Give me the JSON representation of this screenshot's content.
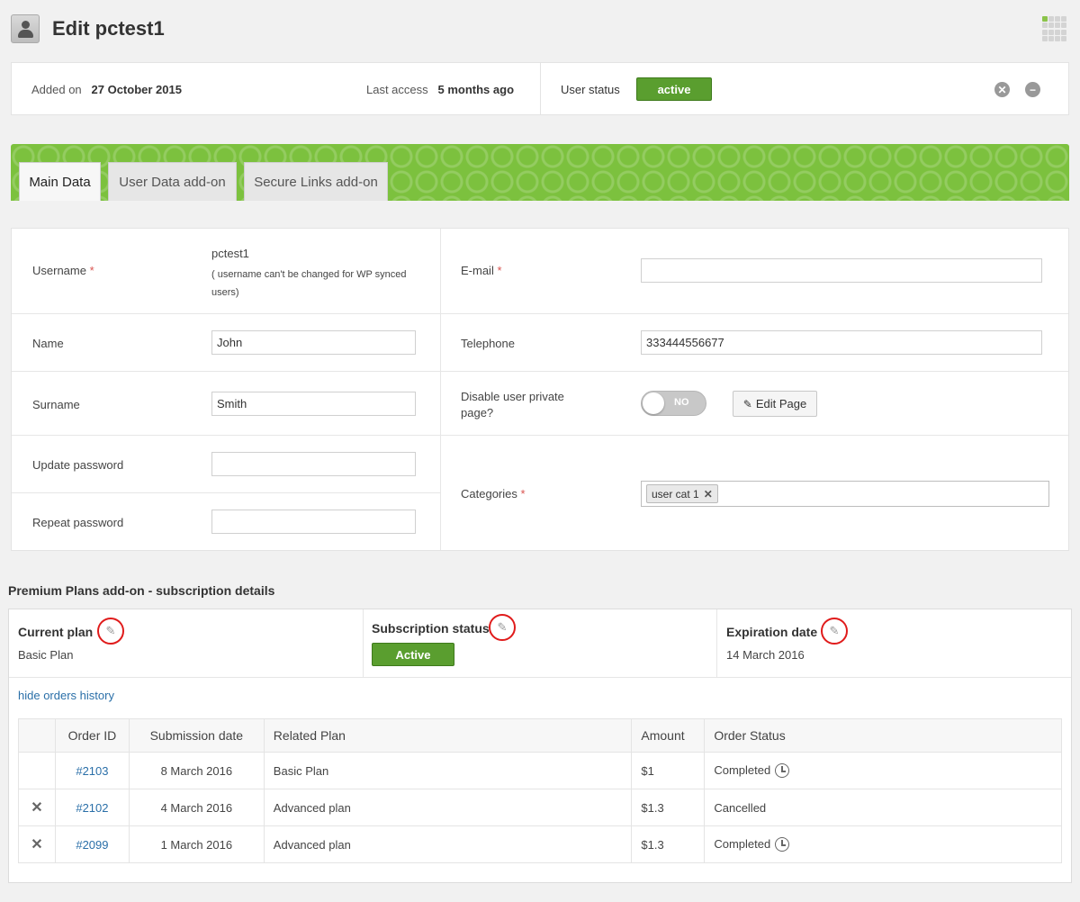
{
  "page": {
    "title": "Edit pctest1"
  },
  "info": {
    "added_label": "Added on",
    "added_value": "27 October 2015",
    "access_label": "Last access",
    "access_value": "5 months ago",
    "status_label": "User status",
    "status_value": "active"
  },
  "tabs": [
    {
      "label": "Main Data",
      "active": true
    },
    {
      "label": "User Data add-on",
      "active": false
    },
    {
      "label": "Secure Links add-on",
      "active": false
    }
  ],
  "form": {
    "username_label": "Username",
    "username_value": "pctest1",
    "username_note": "( username can't be changed for WP synced users)",
    "email_label": "E-mail",
    "email_value": "",
    "name_label": "Name",
    "name_value": "John",
    "telephone_label": "Telephone",
    "telephone_value": "333444556677",
    "surname_label": "Surname",
    "surname_value": "Smith",
    "disable_label": "Disable user private page?",
    "toggle_text": "NO",
    "edit_page_label": "Edit Page",
    "update_password_label": "Update password",
    "repeat_password_label": "Repeat password",
    "categories_label": "Categories",
    "category_chip": "user cat 1",
    "required_mark": "*"
  },
  "plans": {
    "section_title": "Premium Plans add-on - subscription details",
    "current_plan_label": "Current plan",
    "current_plan_value": "Basic Plan",
    "subscription_status_label": "Subscription status",
    "subscription_status_value": "Active",
    "expiration_label": "Expiration date",
    "expiration_value": "14 March 2016",
    "history_link": "hide orders history"
  },
  "orders": {
    "headers": [
      "Order ID",
      "Submission date",
      "Related Plan",
      "Amount",
      "Order Status"
    ],
    "rows": [
      {
        "deletable": false,
        "id": "#2103",
        "date": "8 March 2016",
        "plan": "Basic Plan",
        "amount": "$1",
        "status": "Completed",
        "clock": true
      },
      {
        "deletable": true,
        "id": "#2102",
        "date": "4 March 2016",
        "plan": "Advanced plan",
        "amount": "$1.3",
        "status": "Cancelled",
        "clock": false
      },
      {
        "deletable": true,
        "id": "#2099",
        "date": "1 March 2016",
        "plan": "Advanced plan",
        "amount": "$1.3",
        "status": "Completed",
        "clock": true
      }
    ]
  },
  "colors": {
    "accent_green": "#7cc13e",
    "status_green": "#5a9e2f",
    "link_blue": "#2a6fa8",
    "highlight_red": "#e01b1b"
  }
}
